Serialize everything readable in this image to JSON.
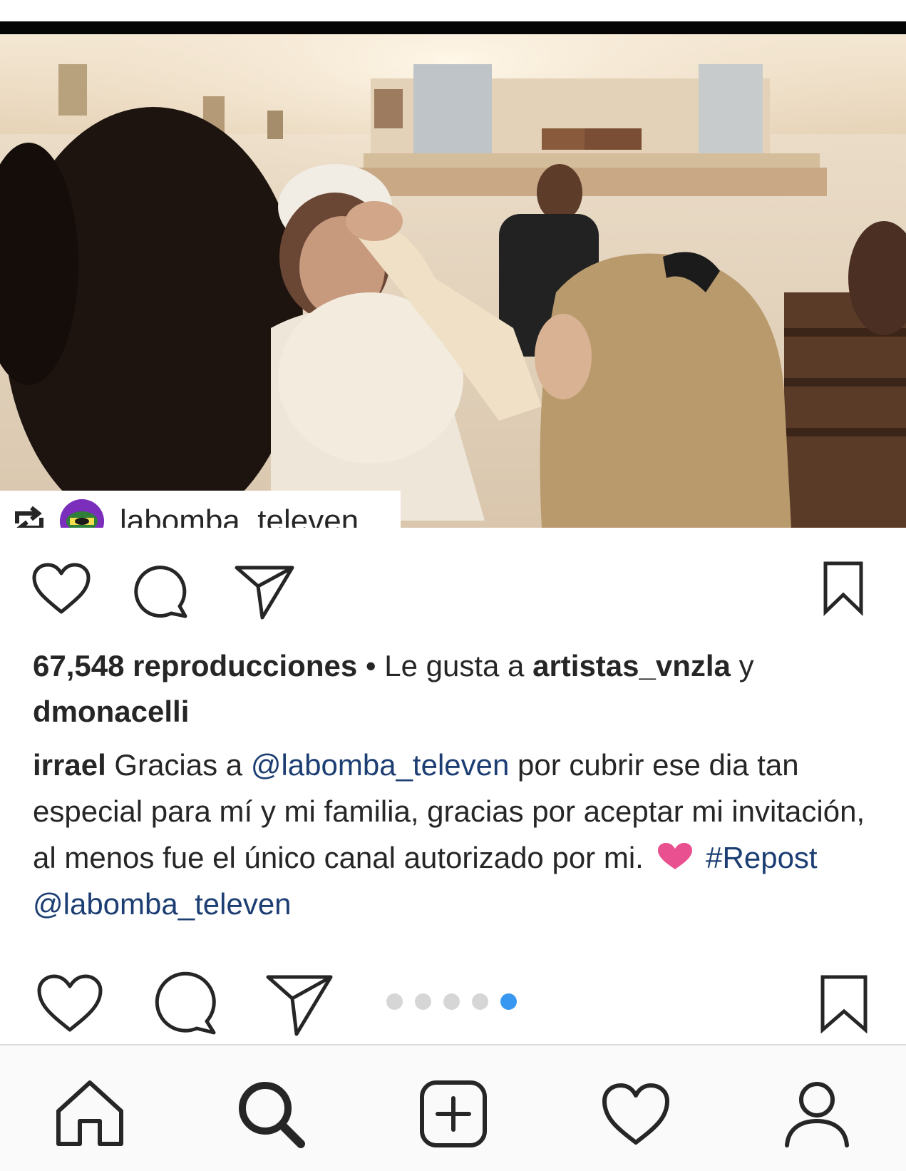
{
  "post": {
    "repost_username": "labomba_televen",
    "views_text": "67,548 reproducciones",
    "separator": " • Le gusta a ",
    "liked_by_1": "artistas_vnzla",
    "and_text": " y",
    "liked_by_2": "dmonacelli",
    "caption": {
      "author": "irrael",
      "text_1": " Gracias a ",
      "mention_1": "@labomba_televen",
      "text_2": " por cubrir ese dia tan especial para mí y mi familia, gracias por aceptar mi invitación, al menos fue el único canal autorizado por mi. ",
      "hashtag": "#Repost",
      "mention_2": "@labomba_televen"
    },
    "carousel": {
      "total": 5,
      "active_index": 5
    }
  },
  "bottom_nav": {
    "items": [
      {
        "icon": "home-icon"
      },
      {
        "icon": "search-icon"
      },
      {
        "icon": "add-post-icon"
      },
      {
        "icon": "activity-heart-icon"
      },
      {
        "icon": "profile-icon"
      }
    ]
  },
  "colors": {
    "text": "#262626",
    "link": "#1c3e73",
    "active_dot": "#3897f0",
    "inactive_dot": "#d6d6d6",
    "heart_emoji": "#e8508f"
  }
}
